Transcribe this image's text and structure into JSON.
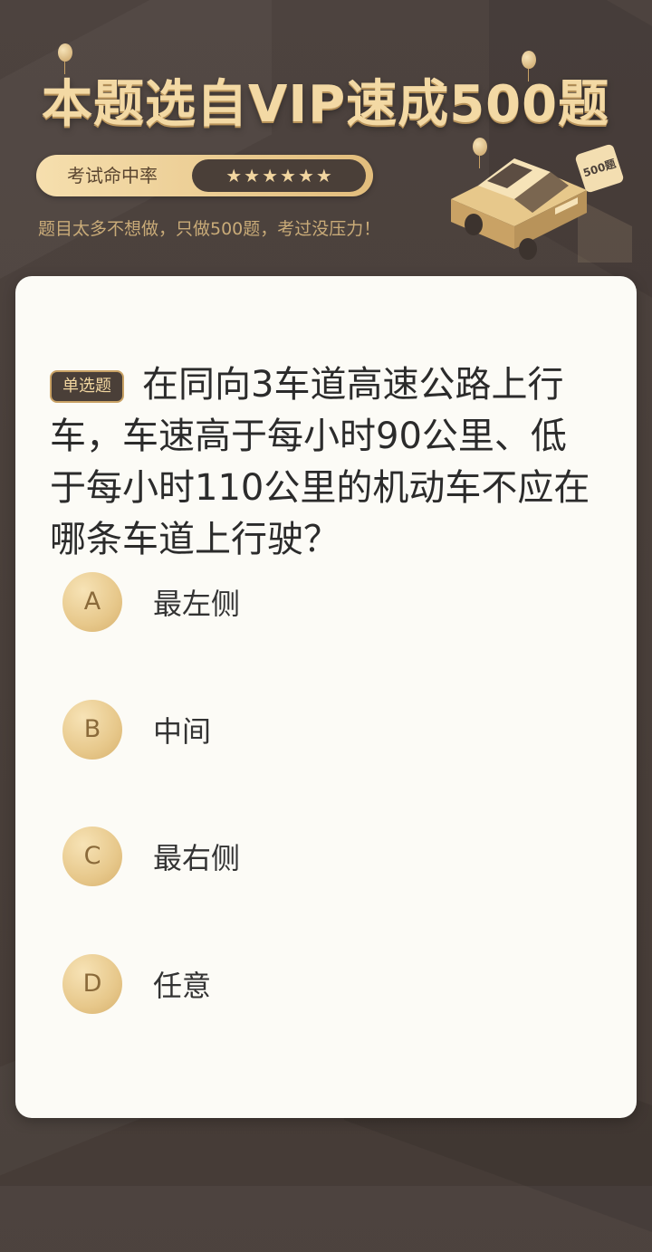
{
  "banner": {
    "title": "本题选自VIP速成500题",
    "rate_label": "考试命中率",
    "stars": [
      "★",
      "★",
      "★",
      "★",
      "★",
      "★"
    ],
    "subtitle": "题目太多不想做，只做500题，考过没压力！",
    "badge_text": "500题"
  },
  "question": {
    "type_label": "单选题",
    "text": "在同向3车道高速公路上行车，车速高于每小时90公里、低于每小时110公里的机动车不应在哪条车道上行驶？",
    "options": [
      {
        "letter": "A",
        "text": "最左侧"
      },
      {
        "letter": "B",
        "text": "中间"
      },
      {
        "letter": "C",
        "text": "最右侧"
      },
      {
        "letter": "D",
        "text": "任意"
      }
    ]
  },
  "colors": {
    "background": "#4a403b",
    "gold": "#f3d9a4",
    "card": "#fcfbf6"
  }
}
